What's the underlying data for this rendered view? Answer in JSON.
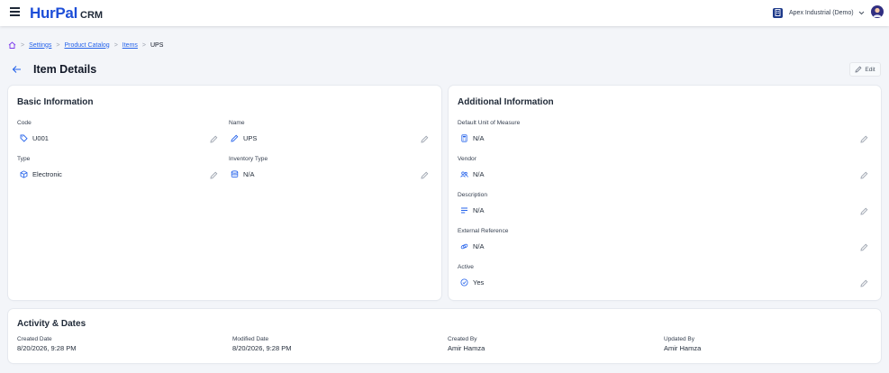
{
  "header": {
    "brand": "HurPal",
    "brand_suffix": "CRM",
    "org_name": "Apex Industrial (Demo)"
  },
  "breadcrumb": {
    "items": [
      "Settings",
      "Product Catalog",
      "Items"
    ],
    "current": "UPS"
  },
  "page": {
    "title": "Item Details",
    "edit_label": "Edit"
  },
  "basic_info": {
    "title": "Basic Information",
    "fields": [
      {
        "label": "Code",
        "value": "U001",
        "icon": "tag-icon"
      },
      {
        "label": "Name",
        "value": "UPS",
        "icon": "pencil-icon"
      },
      {
        "label": "Type",
        "value": "Electronic",
        "icon": "box-icon"
      },
      {
        "label": "Inventory Type",
        "value": "N/A",
        "icon": "database-icon"
      }
    ]
  },
  "additional_info": {
    "title": "Additional Information",
    "fields": [
      {
        "label": "Default Unit of Measure",
        "value": "N/A",
        "icon": "calculator-icon"
      },
      {
        "label": "Vendor",
        "value": "N/A",
        "icon": "users-icon"
      },
      {
        "label": "Description",
        "value": "N/A",
        "icon": "text-lines-icon"
      },
      {
        "label": "External Reference",
        "value": "N/A",
        "icon": "link-icon"
      },
      {
        "label": "Active",
        "value": "Yes",
        "icon": "check-circle-icon"
      }
    ]
  },
  "activity": {
    "title": "Activity & Dates",
    "items": [
      {
        "label": "Created Date",
        "value": "8/20/2026, 9:28 PM"
      },
      {
        "label": "Modified Date",
        "value": "8/20/2026, 9:28 PM"
      },
      {
        "label": "Created By",
        "value": "Amir Hamza"
      },
      {
        "label": "Updated By",
        "value": "Amir Hamza"
      }
    ]
  },
  "colors": {
    "accent": "#2563eb",
    "brand": "#1d4ed8",
    "background": "#f3f5f9"
  }
}
